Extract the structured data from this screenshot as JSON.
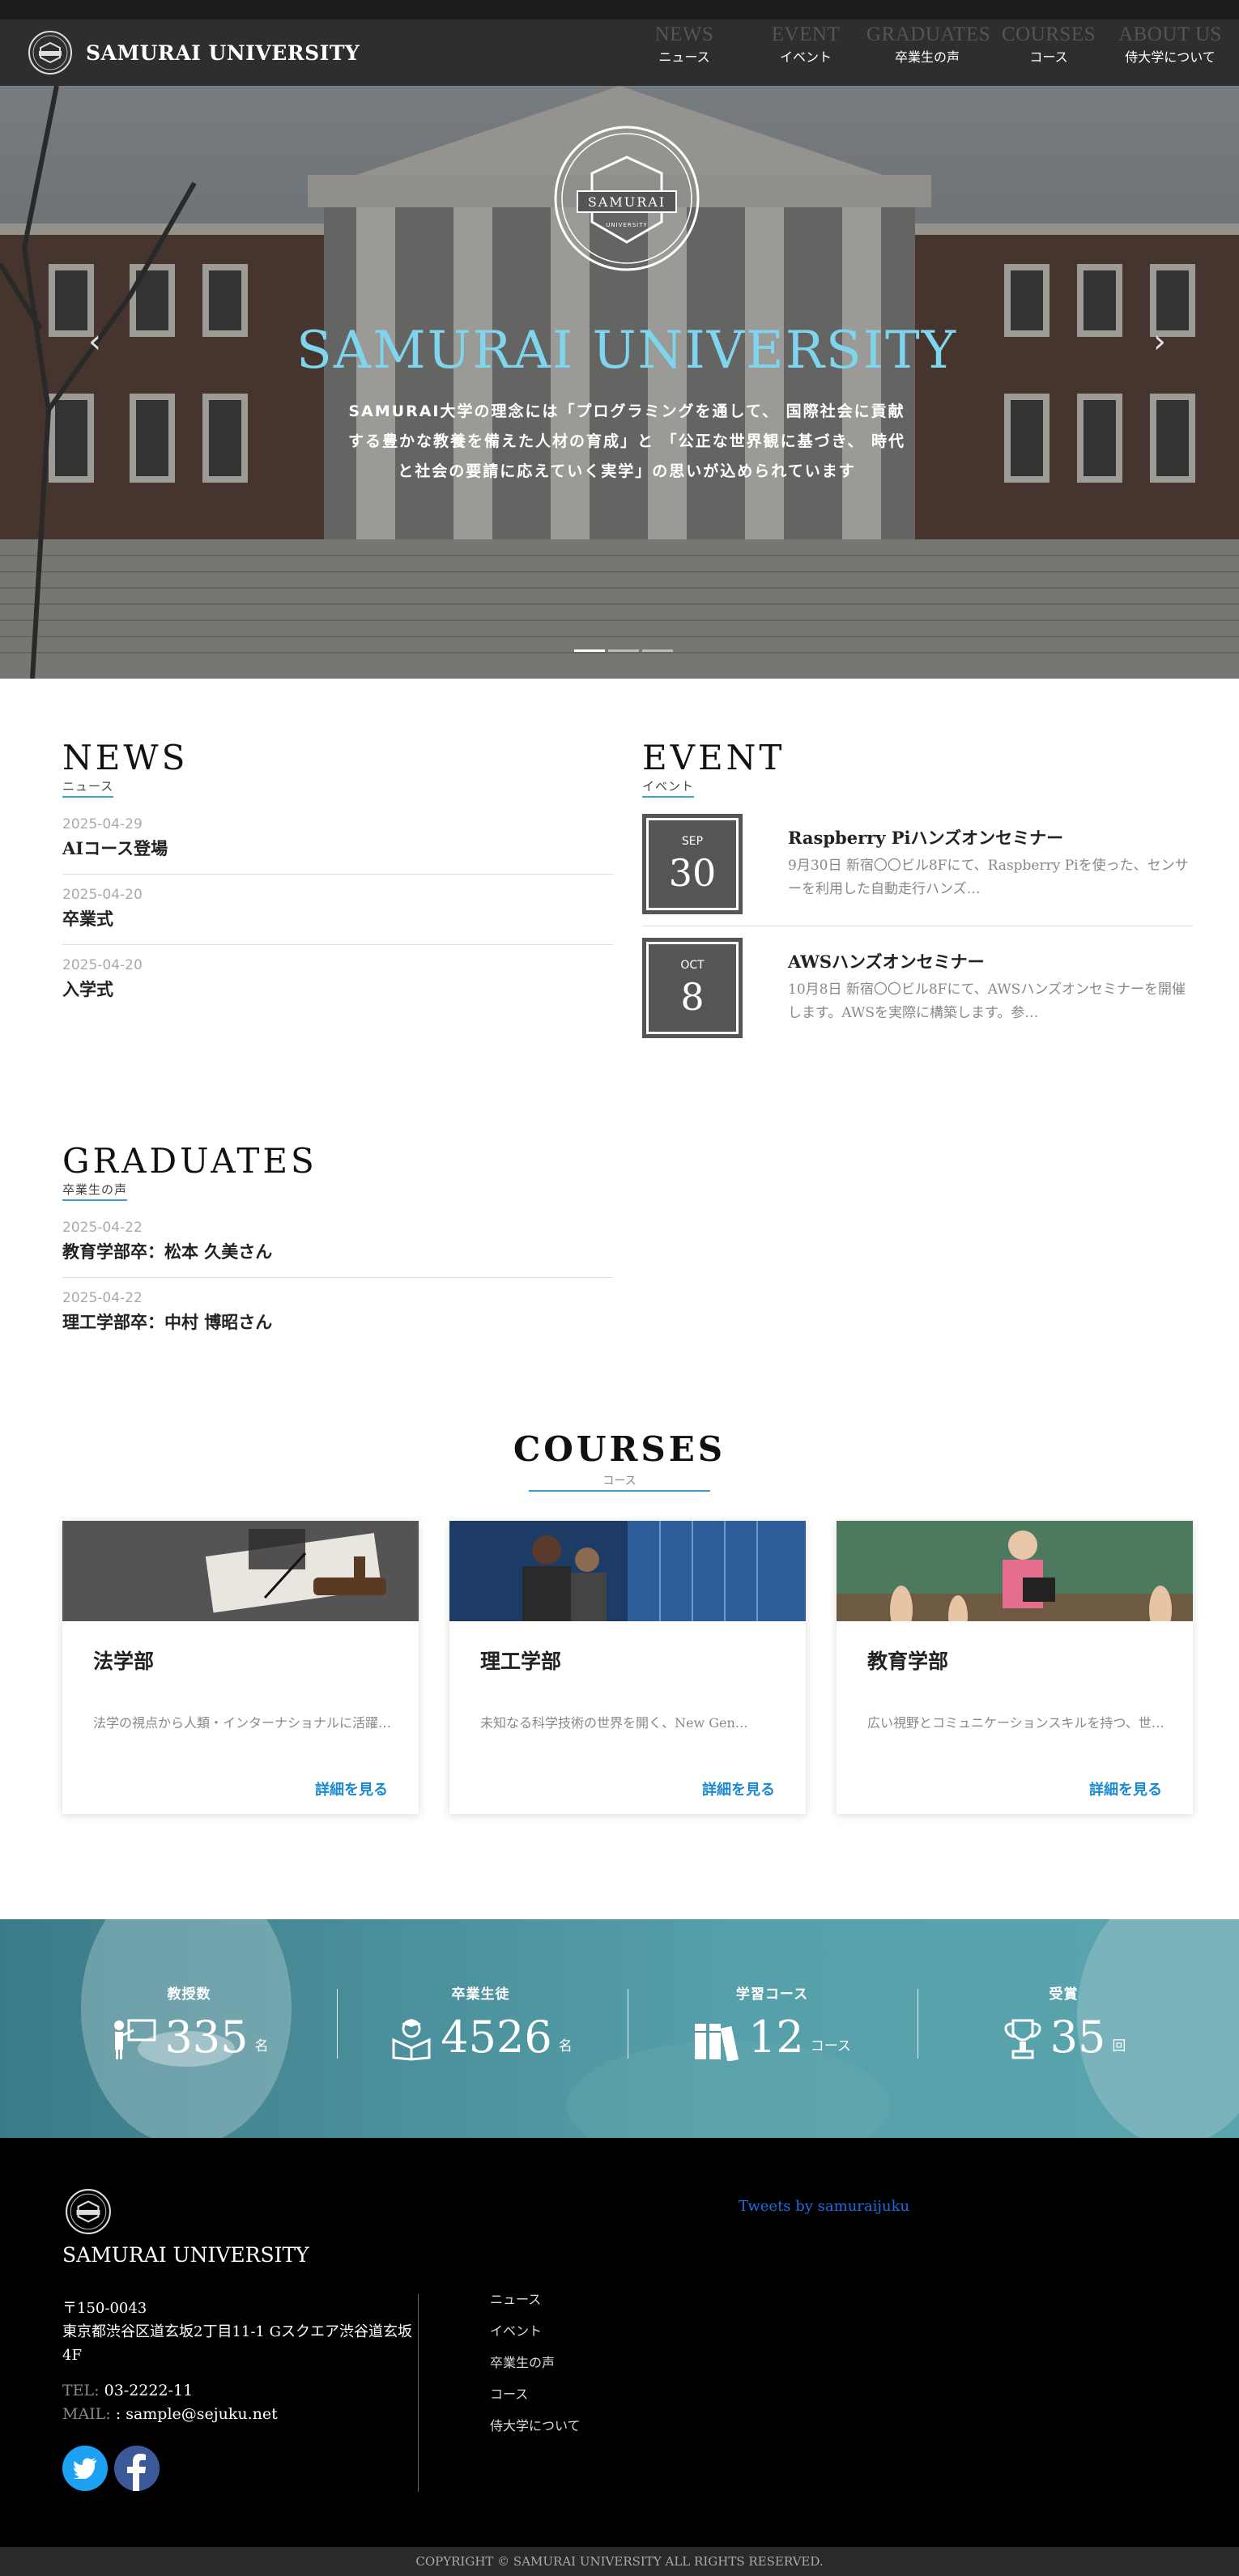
{
  "brand": {
    "name": "SAMURAI UNIVERSITY"
  },
  "nav": [
    {
      "en": "NEWS",
      "jp": "ニュース"
    },
    {
      "en": "EVENT",
      "jp": "イベント"
    },
    {
      "en": "GRADUATES",
      "jp": "卒業生の声"
    },
    {
      "en": "COURSES",
      "jp": "コース"
    },
    {
      "en": "ABOUT US",
      "jp": "侍大学について"
    }
  ],
  "hero": {
    "emblem_text": "SAMURAI",
    "emblem_small": "UNIVERSITY",
    "title": "SAMURAI UNIVERSITY",
    "description": "SAMURAI大学の理念には「プログラミングを通して、 国際社会に貢献する豊かな教養を備えた人材の育成」と 「公正な世界観に基づき、 時代と社会の要請に応えていく実学」の思いが込められています",
    "slides": 3,
    "active_slide": 1
  },
  "news": {
    "title": "NEWS",
    "subtitle": "ニュース",
    "items": [
      {
        "date": "2025-04-29",
        "title": "AIコース登場"
      },
      {
        "date": "2025-04-20",
        "title": "卒業式"
      },
      {
        "date": "2025-04-20",
        "title": "入学式"
      }
    ]
  },
  "event": {
    "title": "EVENT",
    "subtitle": "イベント",
    "items": [
      {
        "month": "SEP",
        "day": "30",
        "title": "Raspberry Piハンズオンセミナー",
        "desc": "9月30日 新宿〇〇ビル8Fにて、Raspberry Piを使った、センサーを利用した自動走行ハンズ…"
      },
      {
        "month": "OCT",
        "day": "8",
        "title": "AWSハンズオンセミナー",
        "desc": "10月8日 新宿〇〇ビル8Fにて、AWSハンズオンセミナーを開催します。AWSを実際に構築します。参…"
      }
    ]
  },
  "graduates": {
    "title": "GRADUATES",
    "subtitle": "卒業生の声",
    "items": [
      {
        "date": "2025-04-22",
        "title": "教育学部卒：松本 久美さん"
      },
      {
        "date": "2025-04-22",
        "title": "理工学部卒：中村 博昭さん"
      }
    ]
  },
  "courses": {
    "title": "COURSES",
    "subtitle": "コース",
    "items": [
      {
        "title": "法学部",
        "desc": "法学の視点から人類・インターナショナルに活躍…",
        "link": "詳細を見る"
      },
      {
        "title": "理工学部",
        "desc": "未知なる科学技術の世界を開く、New Gen…",
        "link": "詳細を見る"
      },
      {
        "title": "教育学部",
        "desc": "広い視野とコミュニケーションスキルを持つ、世…",
        "link": "詳細を見る"
      }
    ]
  },
  "stats": [
    {
      "label": "教授数",
      "value": "335",
      "unit": "名",
      "icon": "professor-icon"
    },
    {
      "label": "卒業生徒",
      "value": "4526",
      "unit": "名",
      "icon": "graduate-icon"
    },
    {
      "label": "学習コース",
      "value": "12",
      "unit": "コース",
      "icon": "books-icon"
    },
    {
      "label": "受賞",
      "value": "35",
      "unit": "回",
      "icon": "trophy-icon"
    }
  ],
  "footer": {
    "name": "SAMURAI UNIVERSITY",
    "address": "〒150-0043\n東京都渋谷区道玄坂2丁目11-1 Gスクエア渋谷道玄坂4F",
    "tel_label": "TEL:",
    "tel": "03-2222-11",
    "mail_label": "MAIL:",
    "mail": ": sample@sejuku.net",
    "links": [
      "ニュース",
      "イベント",
      "卒業生の声",
      "コース",
      "侍大学について"
    ],
    "tweets": "Tweets by samuraijuku",
    "copyright": "COPYRIGHT © SAMURAI UNIVERSITY ALL RIGHTS RESERVED.",
    "social": [
      {
        "name": "twitter",
        "color": "#1da1f2"
      },
      {
        "name": "facebook",
        "color": "#3b5998"
      }
    ]
  },
  "colors": {
    "accent": "#3aa0d0",
    "hero_title": "#7fd4ee",
    "link": "#1a8ad4"
  }
}
